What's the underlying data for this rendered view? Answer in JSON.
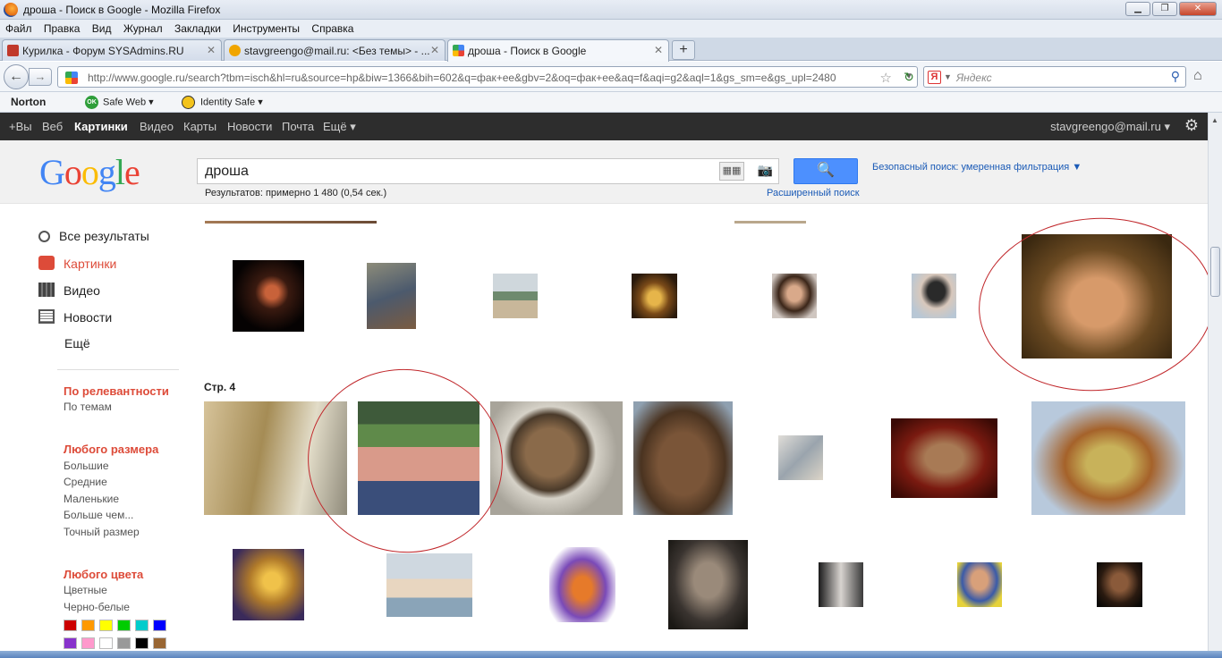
{
  "window": {
    "title": "дроша - Поиск в Google - Mozilla Firefox",
    "min": "▁",
    "max": "❐",
    "close": "✕"
  },
  "menu": [
    "Файл",
    "Правка",
    "Вид",
    "Журнал",
    "Закладки",
    "Инструменты",
    "Справка"
  ],
  "tabs": [
    {
      "label": "Курилка - Форум SYSAdmins.RU",
      "color": "#c0392b"
    },
    {
      "label": "stavgreengo@mail.ru: <Без темы> - ...",
      "color": "#f0a500"
    },
    {
      "label": "дроша - Поиск в Google",
      "color": "#4285f4"
    }
  ],
  "nav": {
    "url": "http://www.google.ru/search?tbm=isch&hl=ru&source=hp&biw=1366&bih=602&q=фак+ее&gbv=2&oq=фак+ее&aq=f&aqi=g2&aql=1&gs_sm=e&gs_upl=2480",
    "search_placeholder": "Яндекс",
    "back": "←",
    "forward": "→",
    "reload": "↻",
    "star": "☆",
    "home": "⌂",
    "search_icon": "⚲",
    "yandex_letter": "Я"
  },
  "norton": {
    "logo": "Norton",
    "safe_web": "Safe Web ▾",
    "ok": "OK",
    "identity": "Identity Safe ▾"
  },
  "gbar": {
    "items": [
      "+Вы",
      "Веб",
      "Картинки",
      "Видео",
      "Карты",
      "Новости",
      "Почта",
      "Ещё ▾"
    ],
    "account": "stavgreengo@mail.ru ▾",
    "gear": "⚙"
  },
  "search": {
    "logo": "Google",
    "query": "дроша",
    "results_count": "Результатов: примерно 1 480 (0,54 сек.)",
    "advanced": "Расширенный поиск",
    "safe": "Безопасный поиск: умеренная фильтрация ▼",
    "button_icon": "🔍"
  },
  "left_nav": {
    "main": [
      "Все результаты",
      "Картинки",
      "Видео",
      "Новости",
      "Ещё"
    ],
    "sort_title": "По релевантности",
    "sort_sub": "По темам",
    "size_title": "Любого размера",
    "sizes": [
      "Большие",
      "Средние",
      "Маленькие",
      "Больше чем...",
      "Точный размер"
    ],
    "color_title": "Любого цвета",
    "color_opts": [
      "Цветные",
      "Черно-белые"
    ],
    "swatches": [
      "#cc0000",
      "#ff9900",
      "#ffff00",
      "#00cc00",
      "#00cccc",
      "#0000ff",
      "#8833cc",
      "#ff99cc",
      "#ffffff",
      "#999999",
      "#000000",
      "#996633"
    ]
  },
  "results": {
    "page_label": "Стр. 4"
  }
}
